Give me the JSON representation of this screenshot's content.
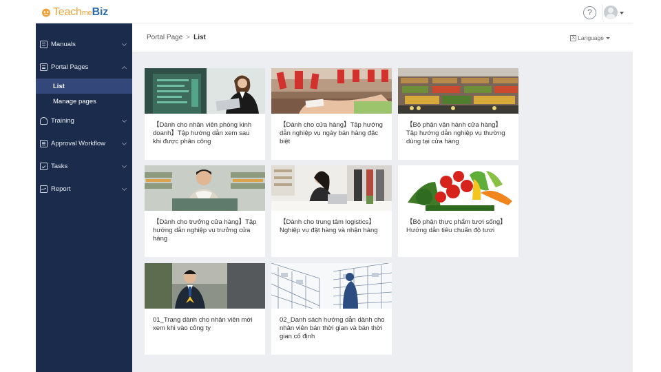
{
  "header": {
    "logo": {
      "teach": "Teach",
      "me": "me",
      "biz": "Biz"
    },
    "help_label": "?"
  },
  "sidebar": {
    "items": [
      {
        "label": "Manuals",
        "icon": "book-icon"
      },
      {
        "label": "Portal Pages",
        "icon": "document-icon",
        "expanded": true
      },
      {
        "label": "Training",
        "icon": "graduation-cap-icon"
      },
      {
        "label": "Approval Workflow",
        "icon": "clipboard-icon"
      },
      {
        "label": "Tasks",
        "icon": "checklist-icon"
      },
      {
        "label": "Report",
        "icon": "chart-icon"
      }
    ],
    "portal_sub": [
      {
        "label": "List",
        "active": true
      },
      {
        "label": "Manage pages"
      }
    ]
  },
  "breadcrumb": {
    "root": "Portal Page",
    "sep": ">",
    "current": "List"
  },
  "language": {
    "label": "Language",
    "icon": "translate-icon"
  },
  "cards": [
    {
      "title": "【Dành cho nhân viên phòng kinh doanh】Tập hướng dẫn xem sau khi được phân công",
      "image": "sales-woman-laptop"
    },
    {
      "title": "【Dành cho cửa hàng】Tập hướng dẫn nghiệp vụ ngày bán hàng đặc biệt",
      "image": "price-tags-shelf"
    },
    {
      "title": "【Bộ phận vận hành cửa hàng】Tập hướng dẫn nghiệp vụ thường dùng tại cửa hàng",
      "image": "produce-section"
    },
    {
      "title": "【Dành cho trưởng cửa hàng】Tập hướng dẫn nghiệp vụ trưởng cửa hàng",
      "image": "store-manager"
    },
    {
      "title": "【Dành cho trung tâm logistics】Nghiệp vụ đặt hàng và nhận hàng",
      "image": "woman-desk-laptop"
    },
    {
      "title": "【Bộ phận thực phẩm tươi sống】Hướng dẫn tiêu chuẩn độ tươi",
      "image": "fresh-vegetables"
    },
    {
      "title": "01_Trang dành cho nhân viên mới xem khi vào công ty",
      "image": "new-employee"
    },
    {
      "title": "02_Danh sách hướng dẫn dành cho nhân viên bán thời gian và bán thời gian cố định",
      "image": "shelf-illustration"
    }
  ],
  "colors": {
    "sidebar_bg": "#1a2b4c",
    "sidebar_active": "#34477a",
    "brand_orange": "#f0a33a",
    "brand_blue": "#2b6aa8",
    "content_bg": "#eceef2"
  }
}
